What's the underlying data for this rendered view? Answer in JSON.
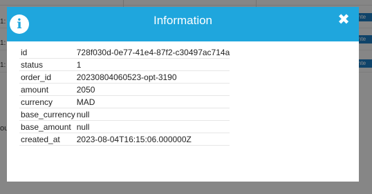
{
  "background": {
    "row_prefix": "1:",
    "button_label": "ttente",
    "left_word": "ou"
  },
  "modal": {
    "title": "Information",
    "icon": "info-icon",
    "close_icon": "close-icon",
    "fields": [
      {
        "key": "id",
        "value": "728f030d-0e77-41e4-87f2-c30497ac714a"
      },
      {
        "key": "status",
        "value": "1"
      },
      {
        "key": "order_id",
        "value": "20230804060523-opt-3190"
      },
      {
        "key": "amount",
        "value": "2050"
      },
      {
        "key": "currency",
        "value": "MAD"
      },
      {
        "key": "base_currency",
        "value": "null"
      },
      {
        "key": "base_amount",
        "value": "null"
      },
      {
        "key": "created_at",
        "value": "2023-08-04T16:15:06.000000Z"
      }
    ]
  },
  "colors": {
    "header": "#1fa6dd",
    "button": "#1c7bbf"
  }
}
